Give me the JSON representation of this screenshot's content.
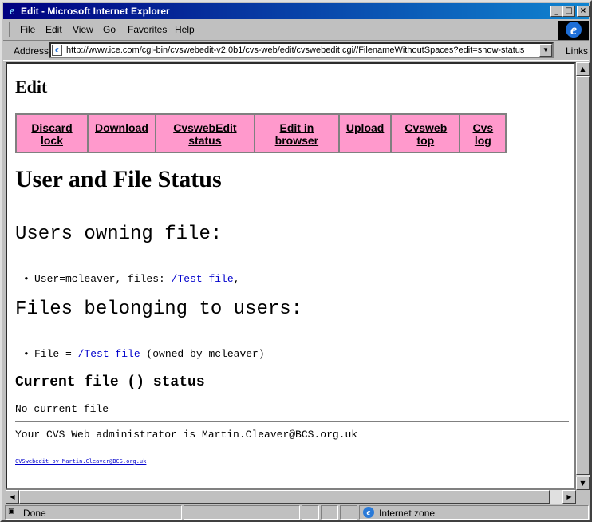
{
  "window": {
    "title": "Edit - Microsoft Internet Explorer"
  },
  "menu": {
    "items": [
      "File",
      "Edit",
      "View",
      "Go",
      "Favorites",
      "Help"
    ]
  },
  "address": {
    "label": "Address",
    "url": "http://www.ice.com/cgi-bin/cvswebedit-v2.0b1/cvs-web/edit/cvswebedit.cgi//FilenameWithoutSpaces?edit=show-status",
    "links_label": "Links"
  },
  "page": {
    "heading": "Edit",
    "nav": [
      {
        "label": "Discard lock"
      },
      {
        "label": "Download"
      },
      {
        "label": "CvswebEdit status"
      },
      {
        "label": "Edit in browser"
      },
      {
        "label": "Upload"
      },
      {
        "label": "Cvsweb top"
      },
      {
        "label": "Cvs log"
      }
    ],
    "title": "User and File Status",
    "users_heading": "Users owning file:",
    "users_item": {
      "prefix": "User=mcleaver, files: ",
      "link": "/Test file",
      "suffix": ","
    },
    "files_heading": "Files belonging to users:",
    "files_item": {
      "prefix": "File = ",
      "link": "/Test file",
      "suffix": " (owned by mcleaver)"
    },
    "current_heading": "Current file () status",
    "current_text": "No current file",
    "admin_text": "Your CVS Web administrator is Martin.Cleaver@BCS.org.uk",
    "footer_link": "CVSwebedit by Martin.Cleaver@BCS.org.uk"
  },
  "status": {
    "text": "Done",
    "zone": "Internet zone"
  }
}
